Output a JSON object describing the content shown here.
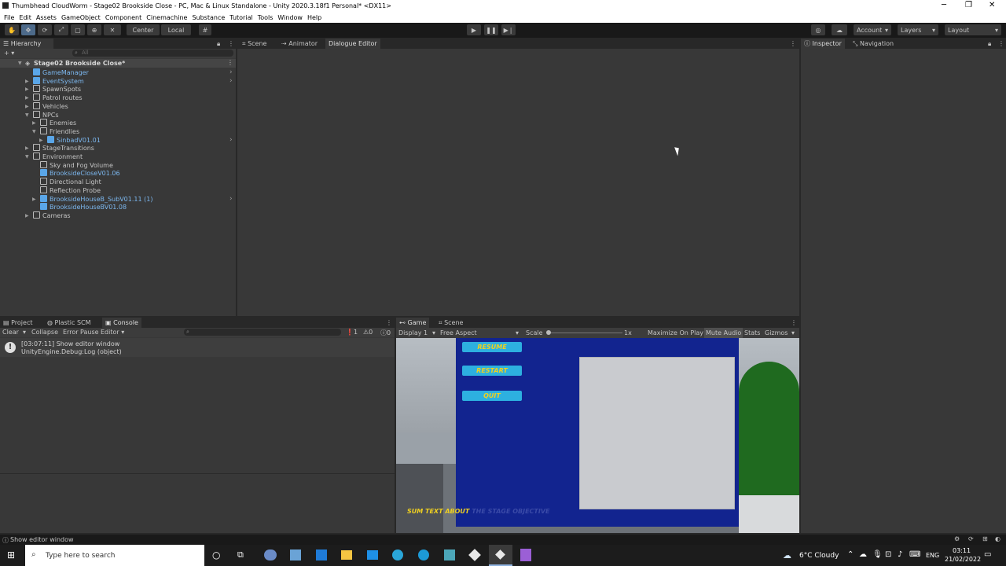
{
  "window": {
    "title": "Thumbhead CloudWorm - Stage02 Brookside Close - PC, Mac & Linux Standalone - Unity 2020.3.18f1 Personal* <DX11>",
    "minimize": "─",
    "maximize": "❐",
    "close": "✕"
  },
  "menu": [
    "File",
    "Edit",
    "Assets",
    "GameObject",
    "Component",
    "Cinemachine",
    "Substance",
    "Tutorial",
    "Tools",
    "Window",
    "Help"
  ],
  "toolbar": {
    "pivot": "Center",
    "space": "Local",
    "account": "Account",
    "layers": "Layers",
    "layout": "Layout"
  },
  "hierarchy": {
    "tab": "Hierarchy",
    "add": "+ ▾",
    "search_placeholder": "All",
    "scene_name": "Stage02 Brookside Close*",
    "items": [
      {
        "label": "GameManager",
        "prefab": true,
        "indent": 0,
        "expand": "",
        "more": true
      },
      {
        "label": "EventSystem",
        "prefab": true,
        "indent": 0,
        "expand": "▶",
        "more": true
      },
      {
        "label": "SpawnSpots",
        "prefab": false,
        "indent": 0,
        "expand": "▶",
        "more": false
      },
      {
        "label": "Patrol routes",
        "prefab": false,
        "indent": 0,
        "expand": "▶",
        "more": false
      },
      {
        "label": "Vehicles",
        "prefab": false,
        "indent": 0,
        "expand": "▶",
        "more": false
      },
      {
        "label": "NPCs",
        "prefab": false,
        "indent": 0,
        "expand": "▼",
        "more": false
      },
      {
        "label": "Enemies",
        "prefab": false,
        "indent": 1,
        "expand": "▶",
        "more": false
      },
      {
        "label": "Friendlies",
        "prefab": false,
        "indent": 1,
        "expand": "▼",
        "more": false
      },
      {
        "label": "SinbadV01.01",
        "prefab": true,
        "indent": 2,
        "expand": "▶",
        "more": true
      },
      {
        "label": "StageTransitions",
        "prefab": false,
        "indent": 0,
        "expand": "▶",
        "more": false
      },
      {
        "label": "Environment",
        "prefab": false,
        "indent": 0,
        "expand": "▼",
        "more": false
      },
      {
        "label": "Sky and Fog Volume",
        "prefab": false,
        "indent": 1,
        "expand": "",
        "more": false
      },
      {
        "label": "BrooksideCloseV01.06",
        "prefab": true,
        "indent": 1,
        "expand": "",
        "more": false
      },
      {
        "label": "Directional Light",
        "prefab": false,
        "indent": 1,
        "expand": "",
        "more": false
      },
      {
        "label": "Reflection Probe",
        "prefab": false,
        "indent": 1,
        "expand": "",
        "more": false
      },
      {
        "label": "BrooksideHouseB_SubV01.11 (1)",
        "prefab": true,
        "indent": 1,
        "expand": "▶",
        "more": true
      },
      {
        "label": "BrooksideHouseBV01.08",
        "prefab": true,
        "indent": 1,
        "expand": "",
        "more": false
      },
      {
        "label": "Cameras",
        "prefab": false,
        "indent": 0,
        "expand": "▶",
        "more": false
      }
    ]
  },
  "center_tabs": [
    "Scene",
    "Animator",
    "Dialogue Editor"
  ],
  "right_tabs": [
    "Inspector",
    "Navigation"
  ],
  "bottom_left_tabs": [
    "Project",
    "Plastic SCM",
    "Console"
  ],
  "console": {
    "clear": "Clear",
    "collapse": "Collapse",
    "error_pause": "Error Pause",
    "editor": "Editor",
    "count_log": "1",
    "count_warn": "0",
    "count_err": "0",
    "entry_line1": "[03:07:11] Show editor window",
    "entry_line2": "UnityEngine.Debug:Log (object)"
  },
  "game_tabs": [
    "Game",
    "Scene"
  ],
  "game_toolbar": {
    "display": "Display 1",
    "aspect": "Free Aspect",
    "scale_label": "Scale",
    "scale_value": "1x",
    "maximize": "Maximize On Play",
    "mute": "Mute Audio",
    "stats": "Stats",
    "gizmos": "Gizmos"
  },
  "game": {
    "resume": "RESUME",
    "restart": "RESTART",
    "quit": "QUIT",
    "objective_bold": "SUM TEXT ABOUT",
    "objective_faded": "THE STAGE OBJECTIVE"
  },
  "status_bar": "Show editor window",
  "taskbar": {
    "search_placeholder": "Type here to search",
    "weather": "6°C  Cloudy",
    "lang": "ENG",
    "time": "03:11",
    "date": "21/02/2022"
  },
  "colors": {
    "accent": "#4d6a8a",
    "prefab_blue": "#7cb8f0",
    "overlay_blue": "#12248f",
    "button_cyan": "#2db0e0",
    "button_text": "#f0d020"
  }
}
